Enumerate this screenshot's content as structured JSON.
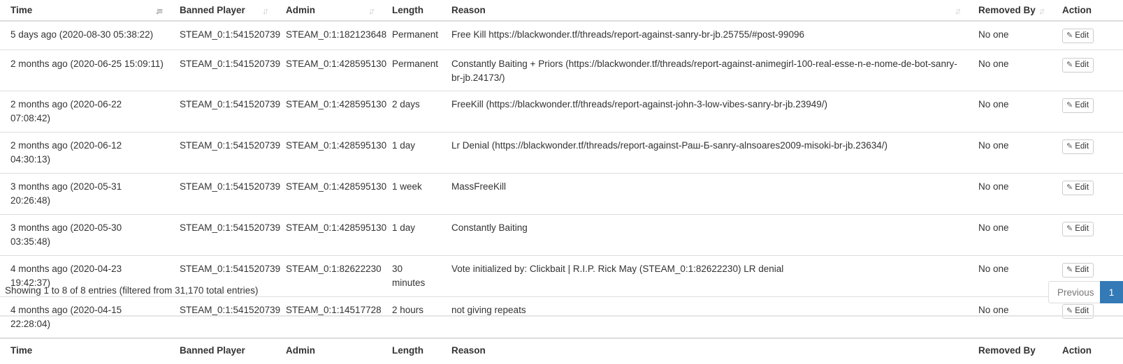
{
  "table": {
    "columns": {
      "time": "Time",
      "banned_player": "Banned Player",
      "admin": "Admin",
      "length": "Length",
      "reason": "Reason",
      "removed_by": "Removed By",
      "action": "Action"
    },
    "sort_icons": {
      "time": "sort-desc-active-icon",
      "other": "sort-both-icon"
    },
    "rows": [
      {
        "time": "5 days ago (2020-08-30 05:38:22)",
        "banned_player": "STEAM_0:1:541520739",
        "admin": "STEAM_0:1:182123648",
        "length": "Permanent",
        "reason": "Free Kill https://blackwonder.tf/threads/report-against-sanry-br-jb.25755/#post-99096",
        "removed_by": "No one",
        "action": "Edit"
      },
      {
        "time": "2 months ago (2020-06-25 15:09:11)",
        "banned_player": "STEAM_0:1:541520739",
        "admin": "STEAM_0:1:428595130",
        "length": "Permanent",
        "reason": "Constantly Baiting + Priors (https://blackwonder.tf/threads/report-against-animegirl-100-real-esse-n-e-nome-de-bot-sanry-br-jb.24173/)",
        "removed_by": "No one",
        "action": "Edit"
      },
      {
        "time": "2 months ago (2020-06-22 07:08:42)",
        "banned_player": "STEAM_0:1:541520739",
        "admin": "STEAM_0:1:428595130",
        "length": "2 days",
        "reason": "FreeKill (https://blackwonder.tf/threads/report-against-john-3-low-vibes-sanry-br-jb.23949/)",
        "removed_by": "No one",
        "action": "Edit"
      },
      {
        "time": "2 months ago (2020-06-12 04:30:13)",
        "banned_player": "STEAM_0:1:541520739",
        "admin": "STEAM_0:1:428595130",
        "length": "1 day",
        "reason": "Lr Denial (https://blackwonder.tf/threads/report-against-Раш-Б-sanry-alnsoares2009-misoki-br-jb.23634/)",
        "removed_by": "No one",
        "action": "Edit"
      },
      {
        "time": "3 months ago (2020-05-31 20:26:48)",
        "banned_player": "STEAM_0:1:541520739",
        "admin": "STEAM_0:1:428595130",
        "length": "1 week",
        "reason": "MassFreeKill",
        "removed_by": "No one",
        "action": "Edit"
      },
      {
        "time": "3 months ago (2020-05-30 03:35:48)",
        "banned_player": "STEAM_0:1:541520739",
        "admin": "STEAM_0:1:428595130",
        "length": "1 day",
        "reason": "Constantly Baiting",
        "removed_by": "No one",
        "action": "Edit"
      },
      {
        "time": "4 months ago (2020-04-23 19:42:37)",
        "banned_player": "STEAM_0:1:541520739",
        "admin": "STEAM_0:1:82622230",
        "length": "30 minutes",
        "reason": "Vote initialized by: Clickbait | R.I.P. Rick May (STEAM_0:1:82622230) LR denial",
        "removed_by": "No one",
        "action": "Edit"
      },
      {
        "time": "4 months ago (2020-04-15 22:28:04)",
        "banned_player": "STEAM_0:1:541520739",
        "admin": "STEAM_0:1:14517728",
        "length": "2 hours",
        "reason": "not giving repeats",
        "removed_by": "No one",
        "action": "Edit"
      }
    ]
  },
  "footer": {
    "info": "Showing 1 to 8 of 8 entries (filtered from 31,170 total entries)",
    "pagination": {
      "previous_label": "Previous",
      "current_page": "1"
    }
  },
  "icons": {
    "edit": "edit-icon"
  },
  "colors": {
    "accent": "#337ab7",
    "border": "#dddddd",
    "text": "#333333"
  }
}
